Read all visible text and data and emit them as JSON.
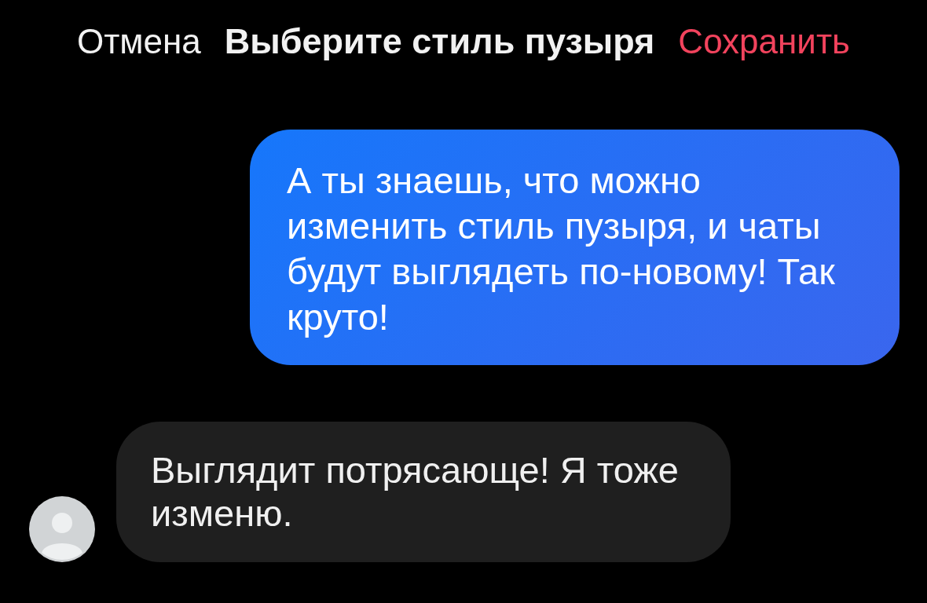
{
  "header": {
    "cancel": "Отмена",
    "title": "Выберите стиль пузыря",
    "save": "Сохранить"
  },
  "messages": [
    {
      "kind": "outgoing",
      "text": "А ты знаешь, что можно изменить стиль пузыря, и чаты будут выглядеть по-новому! Так круто!"
    },
    {
      "kind": "incoming",
      "text": "Выглядит потрясающе! Я тоже изменю."
    }
  ]
}
